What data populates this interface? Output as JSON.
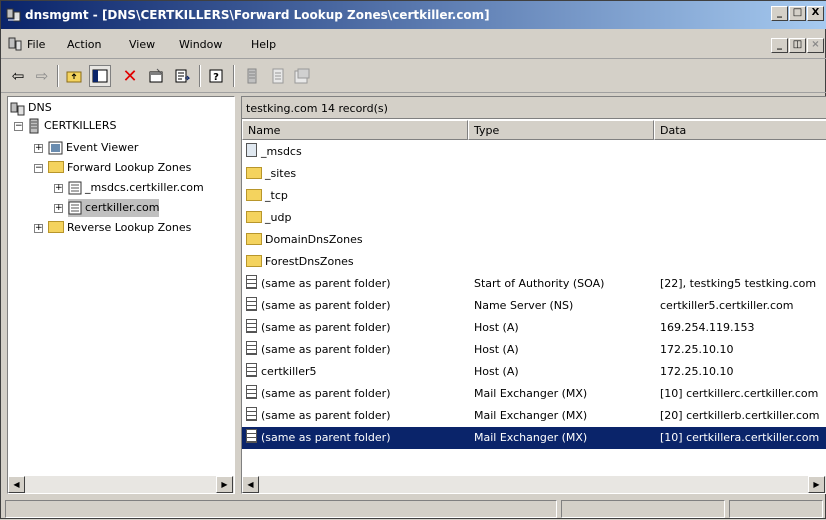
{
  "window": {
    "title": "dnsmgmt - [DNS\\CERTKILLERS\\Forward Lookup Zones\\certkiller.com]",
    "buttons": {
      "minimize": "_",
      "maximize": "□",
      "close": "X"
    }
  },
  "menubar": {
    "items": [
      "File",
      "Action",
      "View",
      "Window",
      "Help"
    ],
    "accel": [
      "F",
      "A",
      "V",
      "W",
      "H"
    ]
  },
  "toolbar": {
    "icons": [
      "back-arrow-icon",
      "forward-arrow-icon",
      "up-folder-icon",
      "show-hide-tree-icon",
      "delete-icon",
      "properties-icon",
      "export-list-icon",
      "help-icon",
      "server-icon",
      "new-zone-icon",
      "new-host-icon"
    ]
  },
  "tree": {
    "items": [
      {
        "label": "DNS"
      },
      {
        "label": "CERTKILLERS"
      },
      {
        "label": "Event Viewer"
      },
      {
        "label": "Forward Lookup Zones"
      },
      {
        "label": "_msdcs.certkiller.com"
      },
      {
        "label": "certkiller.com"
      },
      {
        "label": "Reverse Lookup Zones"
      }
    ]
  },
  "list": {
    "caption": "testking.com   14 record(s)",
    "columns": [
      "Name",
      "Type",
      "Data"
    ],
    "rows": [
      {
        "name": "_msdcs",
        "type": "",
        "data": "",
        "kind": "zone"
      },
      {
        "name": "_sites",
        "type": "",
        "data": "",
        "kind": "folder"
      },
      {
        "name": "_tcp",
        "type": "",
        "data": "",
        "kind": "folder"
      },
      {
        "name": "_udp",
        "type": "",
        "data": "",
        "kind": "folder"
      },
      {
        "name": "DomainDnsZones",
        "type": "",
        "data": "",
        "kind": "folder"
      },
      {
        "name": "ForestDnsZones",
        "type": "",
        "data": "",
        "kind": "folder"
      },
      {
        "name": "(same as parent folder)",
        "type": "Start of Authority (SOA)",
        "data": "[22], testking5 testking.com",
        "kind": "record"
      },
      {
        "name": "(same as parent folder)",
        "type": "Name Server (NS)",
        "data": "certkiller5.certkiller.com",
        "kind": "record"
      },
      {
        "name": "(same as parent folder)",
        "type": "Host (A)",
        "data": "169.254.119.153",
        "kind": "record"
      },
      {
        "name": "(same as parent folder)",
        "type": "Host (A)",
        "data": "172.25.10.10",
        "kind": "record"
      },
      {
        "name": "certkiller5",
        "type": "Host (A)",
        "data": "172.25.10.10",
        "kind": "record"
      },
      {
        "name": "(same as parent folder)",
        "type": "Mail Exchanger (MX)",
        "data": "[10] certkillerc.certkiller.com",
        "kind": "record"
      },
      {
        "name": "(same as parent folder)",
        "type": "Mail Exchanger (MX)",
        "data": "[20] certkillerb.certkiller.com",
        "kind": "record"
      },
      {
        "name": "(same as parent folder)",
        "type": "Mail Exchanger (MX)",
        "data": "[10] certkillera.certkiller.com",
        "kind": "record",
        "selected": true
      }
    ]
  },
  "colors": {
    "title_start": "#0a246a",
    "title_end": "#a6caf0",
    "selection": "#0a246a",
    "face": "#d4d0c8"
  }
}
